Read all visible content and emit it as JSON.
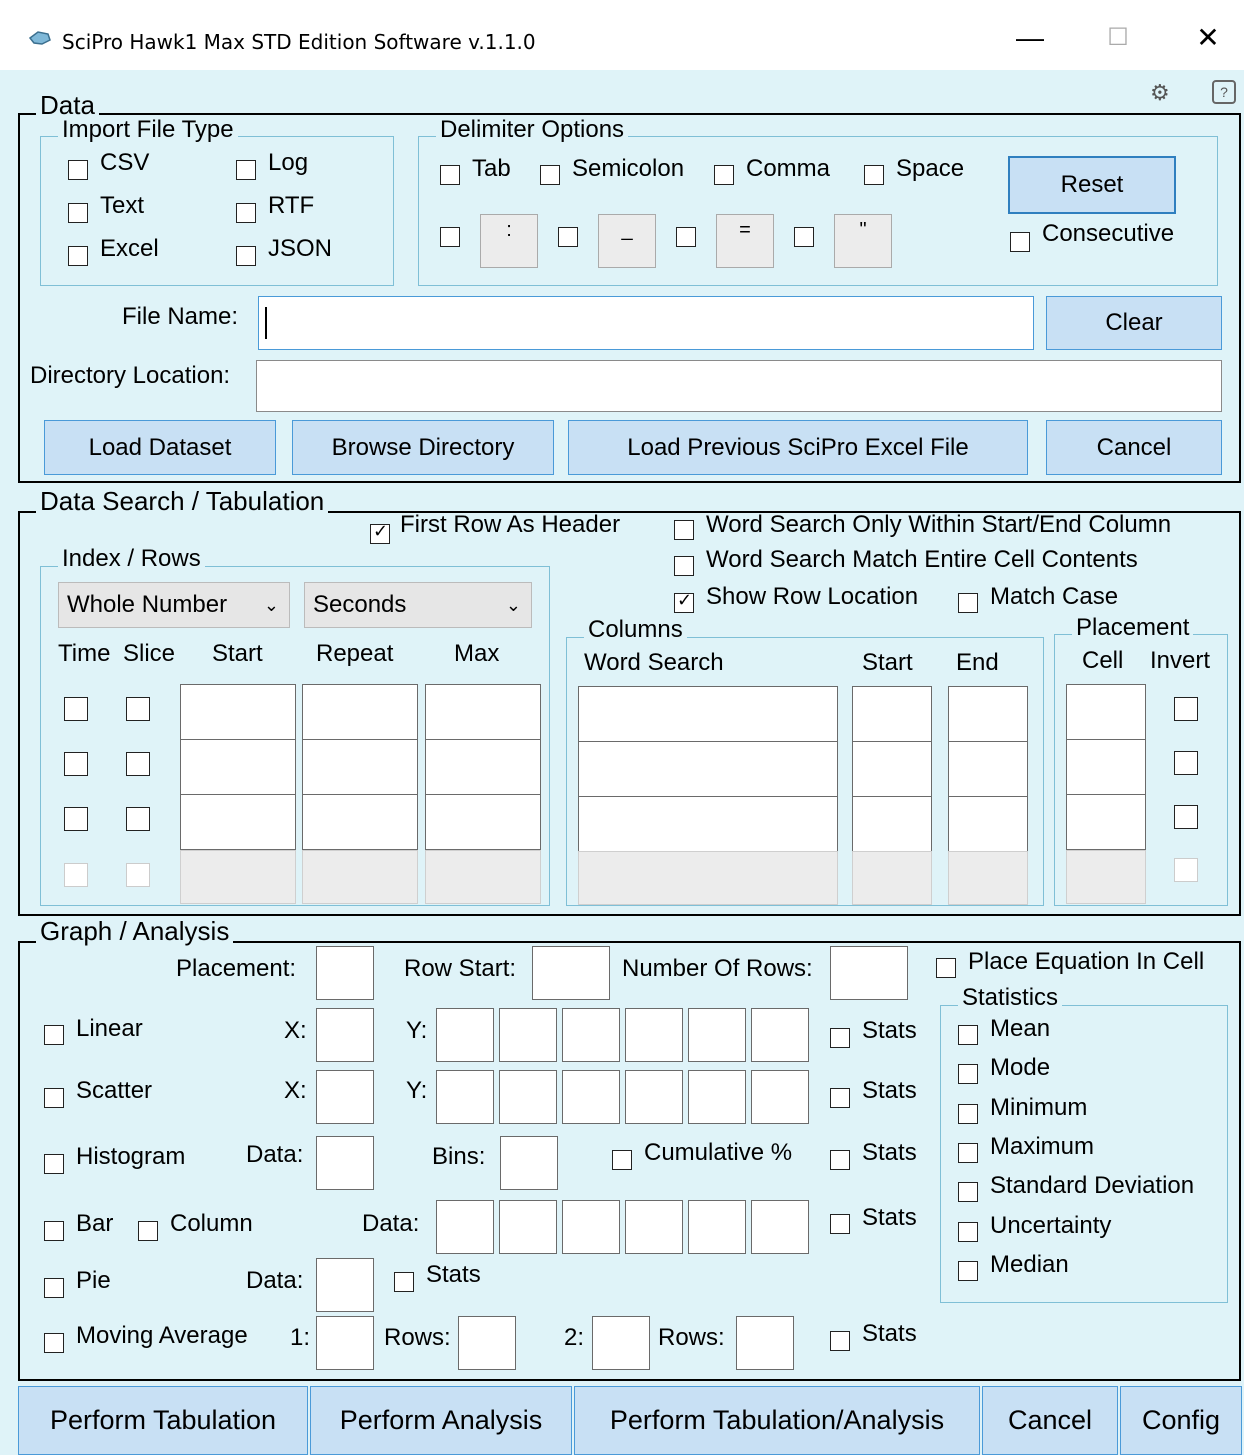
{
  "window": {
    "title": "SciPro Hawk1 Max STD Edition Software v.1.1.0",
    "minimize": "—",
    "maximize": "☐",
    "close": "✕"
  },
  "data_section": {
    "legend": "Data",
    "import": {
      "legend": "Import File Type",
      "csv": "CSV",
      "log": "Log",
      "text": "Text",
      "rtf": "RTF",
      "excel": "Excel",
      "json": "JSON"
    },
    "delimiter": {
      "legend": "Delimiter Options",
      "tab": "Tab",
      "semicolon": "Semicolon",
      "comma": "Comma",
      "space": "Space",
      "sym1": ":",
      "sym2": "_",
      "sym3": "=",
      "sym4": "\"",
      "reset": "Reset",
      "consecutive": "Consecutive"
    },
    "file_name_label": "File Name:",
    "clear": "Clear",
    "directory_label": "Directory Location:",
    "load_dataset": "Load Dataset",
    "browse": "Browse Directory",
    "load_previous": "Load Previous SciPro Excel File",
    "cancel": "Cancel"
  },
  "search_section": {
    "legend": "Data Search / Tabulation",
    "first_row_header": "First Row As Header",
    "word_search_within": "Word Search Only Within Start/End Column",
    "word_search_match": "Word Search Match Entire Cell Contents",
    "show_row_location": "Show Row Location",
    "match_case": "Match Case",
    "index": {
      "legend": "Index / Rows",
      "type": "Whole Number",
      "unit": "Seconds",
      "time": "Time",
      "slice": "Slice",
      "start": "Start",
      "repeat": "Repeat",
      "max": "Max"
    },
    "columns": {
      "legend": "Columns",
      "word_search": "Word Search",
      "start": "Start",
      "end": "End"
    },
    "placement": {
      "legend": "Placement",
      "cell": "Cell",
      "invert": "Invert"
    }
  },
  "graph_section": {
    "legend": "Graph / Analysis",
    "placement": "Placement:",
    "row_start": "Row Start:",
    "number_of_rows": "Number Of Rows:",
    "place_equation": "Place Equation In Cell",
    "linear": "Linear",
    "scatter": "Scatter",
    "histogram": "Histogram",
    "bar": "Bar",
    "column": "Column",
    "pie": "Pie",
    "moving_average": "Moving Average",
    "x": "X:",
    "y": "Y:",
    "data": "Data:",
    "bins": "Bins:",
    "cumulative": "Cumulative %",
    "stats": "Stats",
    "ma1": "1:",
    "ma2": "2:",
    "rows": "Rows:",
    "statistics": {
      "legend": "Statistics",
      "mean": "Mean",
      "mode": "Mode",
      "minimum": "Minimum",
      "maximum": "Maximum",
      "std": "Standard Deviation",
      "uncertainty": "Uncertainty",
      "median": "Median"
    }
  },
  "bottom": {
    "tabulation": "Perform Tabulation",
    "analysis": "Perform Analysis",
    "both": "Perform Tabulation/Analysis",
    "cancel": "Cancel",
    "config": "Config"
  }
}
